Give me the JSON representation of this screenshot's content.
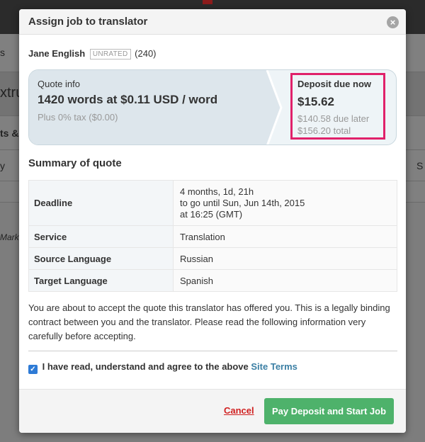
{
  "background": {
    "fragment_1": "s",
    "fragment_2": "xtru",
    "fragment_3": "ts &",
    "fragment_4": "y",
    "fragment_5": "S",
    "fragment_6": "Mark"
  },
  "modal": {
    "title": "Assign job to translator",
    "close_icon": "close-icon",
    "close_glyph": "×"
  },
  "translator": {
    "name": "Jane English",
    "rating_badge": "UNRATED",
    "review_count": "(240)"
  },
  "quote": {
    "label": "Quote info",
    "main": "1420 words at $0.11 USD / word",
    "tax": "Plus 0% tax ($0.00)"
  },
  "deposit": {
    "label": "Deposit due now",
    "amount": "$15.62",
    "due_later": "$140.58 due later",
    "total": "$156.20 total",
    "highlight_color": "#e0216a"
  },
  "summary": {
    "title": "Summary of quote",
    "rows": [
      {
        "label": "Deadline",
        "value_lines": [
          "4 months, 1d, 21h",
          "to go until Sun, Jun 14th, 2015",
          "at 16:25 (GMT)"
        ]
      },
      {
        "label": "Service",
        "value": "Translation"
      },
      {
        "label": "Source Language",
        "value": "Russian"
      },
      {
        "label": "Target Language",
        "value": "Spanish"
      }
    ]
  },
  "notice": "You are about to accept the quote this translator has offered you. This is a legally binding contract between you and the translator. Please read the following information very carefully before accepting.",
  "agreement": {
    "checked": true,
    "text": "I have read, understand and agree to the above",
    "link": "Site Terms",
    "check_glyph": "✓"
  },
  "footer": {
    "cancel": "Cancel",
    "pay": "Pay Deposit and Start Job",
    "pay_color": "#4eb26b"
  }
}
